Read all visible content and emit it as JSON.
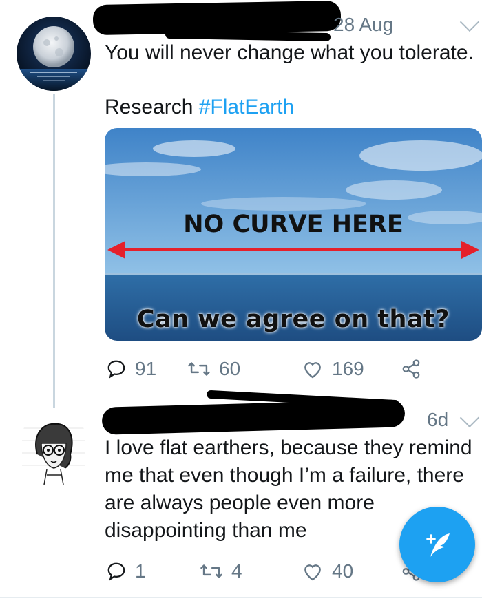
{
  "tweet1": {
    "date": "28 Aug",
    "text_line1": "You will never change what you tolerate.",
    "text_research": "Research ",
    "hashtag": "#FlatEarth",
    "image": {
      "headline": "NO CURVE HERE",
      "caption": "Can we agree on that?"
    },
    "stats": {
      "replies": "91",
      "retweets": "60",
      "likes": "169"
    }
  },
  "tweet2": {
    "date": "6d",
    "lines": [
      "I love flat earthers, because they remind",
      "me that even though I’m a failure, there",
      "are always people even more",
      "disappointing than me"
    ],
    "stats": {
      "replies": "1",
      "retweets": "4",
      "likes": "40"
    }
  },
  "icons": {
    "reply": "reply-icon",
    "retweet": "retweet-icon",
    "like": "heart-icon",
    "share": "share-icon",
    "compose": "compose-tweet-icon",
    "more": "chevron-down-icon"
  },
  "colors": {
    "accent": "#1da1f2",
    "muted": "#657786",
    "text": "#14171a",
    "arrow": "#e5202b"
  }
}
